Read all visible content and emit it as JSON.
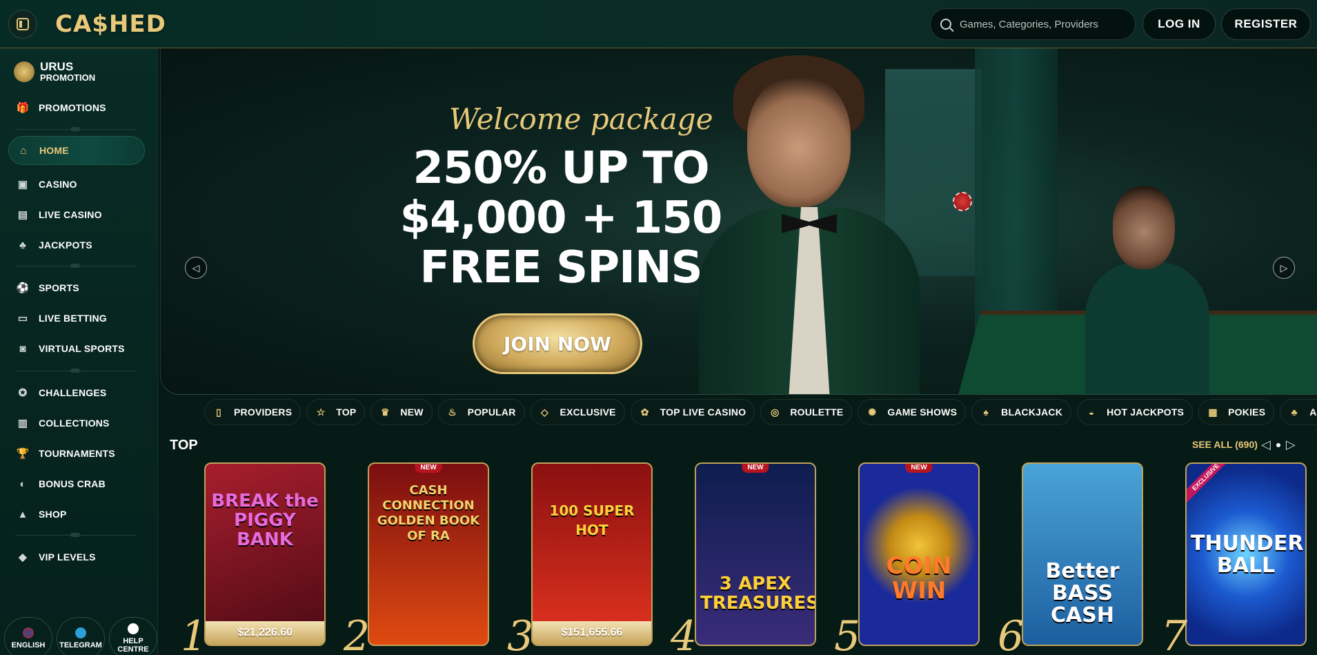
{
  "header": {
    "logo": "CA$HED",
    "search_placeholder": "Games, Categories, Providers",
    "login_label": "LOG IN",
    "register_label": "REGISTER"
  },
  "sidebar": {
    "promo": {
      "line1": "URUS",
      "line2": "PROMOTION"
    },
    "items": [
      {
        "label": "PROMOTIONS",
        "icon": "gift-icon"
      },
      {
        "label": "HOME",
        "icon": "home-icon",
        "active": true
      },
      {
        "label": "CASINO",
        "icon": "casino-icon"
      },
      {
        "label": "LIVE CASINO",
        "icon": "cards-icon"
      },
      {
        "label": "JACKPOTS",
        "icon": "clover-icon"
      },
      {
        "label": "SPORTS",
        "icon": "ball-icon"
      },
      {
        "label": "LIVE BETTING",
        "icon": "live-icon"
      },
      {
        "label": "VIRTUAL SPORTS",
        "icon": "virtual-icon"
      },
      {
        "label": "CHALLENGES",
        "icon": "medal-icon"
      },
      {
        "label": "COLLECTIONS",
        "icon": "collection-icon"
      },
      {
        "label": "TOURNAMENTS",
        "icon": "trophy-icon"
      },
      {
        "label": "BONUS CRAB",
        "icon": "crab-icon"
      },
      {
        "label": "SHOP",
        "icon": "bag-icon"
      },
      {
        "label": "VIP LEVELS",
        "icon": "diamond-icon"
      }
    ],
    "bottom": [
      {
        "label": "ENGLISH"
      },
      {
        "label": "TELEGRAM"
      },
      {
        "label": "HELP CENTRE"
      }
    ]
  },
  "hero": {
    "script": "Welcome package",
    "line1": "250% UP TO",
    "line2": "$4,000 + 150",
    "line3": "FREE SPINS",
    "cta": "JOIN NOW",
    "slides": 2,
    "active_slide": 1
  },
  "categories": [
    {
      "label": "PROVIDERS",
      "icon": "book-icon"
    },
    {
      "label": "TOP",
      "icon": "star-icon"
    },
    {
      "label": "NEW",
      "icon": "new-icon"
    },
    {
      "label": "POPULAR",
      "icon": "fire-icon"
    },
    {
      "label": "EXCLUSIVE",
      "icon": "diamond-icon"
    },
    {
      "label": "TOP LIVE CASINO",
      "icon": "award-icon"
    },
    {
      "label": "ROULETTE",
      "icon": "roulette-icon"
    },
    {
      "label": "GAME SHOWS",
      "icon": "wheel-icon"
    },
    {
      "label": "BLACKJACK",
      "icon": "cards-icon"
    },
    {
      "label": "HOT JACKPOTS",
      "icon": "pot-icon"
    },
    {
      "label": "POKIES",
      "icon": "slot-icon"
    },
    {
      "label": "ALL GAMES",
      "icon": "clover-icon"
    }
  ],
  "top_section": {
    "title": "TOP",
    "see_all": "SEE ALL (690)",
    "games": [
      {
        "rank": "1",
        "title": "BREAK the PIGGY BANK",
        "prize": "$21,226.60",
        "bg": "#7a1020"
      },
      {
        "rank": "2",
        "title": "CASH CONNECTION GOLDEN BOOK OF RA",
        "badge": "NEW",
        "bg": "#a01818"
      },
      {
        "rank": "3",
        "title": "100 SUPER HOT",
        "prize": "$151,655.66",
        "bg": "#c0281e"
      },
      {
        "rank": "4",
        "title": "3 APEX TREASURES",
        "badge": "NEW",
        "bg": "#1c2a6a"
      },
      {
        "rank": "5",
        "title": "COIN WIN",
        "badge": "NEW",
        "bg": "#1a2a9a"
      },
      {
        "rank": "6",
        "title": "Better BASS CASH",
        "bg": "#1f6fb0"
      },
      {
        "rank": "7",
        "title": "THUNDER BALL",
        "badge_ex": "EXCLUSIVE",
        "bg": "#1436a8"
      }
    ]
  }
}
